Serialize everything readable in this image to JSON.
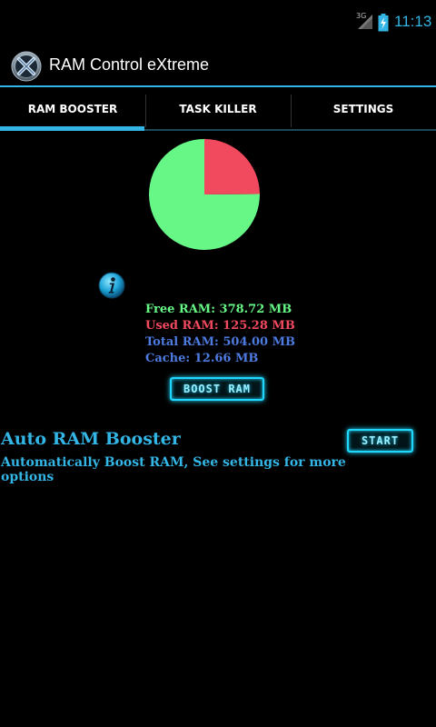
{
  "status_bar": {
    "network": "3G",
    "time": "11:13"
  },
  "app": {
    "title": "RAM Control eXtreme",
    "icon": "x-logo-icon"
  },
  "tabs": [
    {
      "label": "RAM BOOSTER",
      "selected": true
    },
    {
      "label": "TASK KILLER",
      "selected": false
    },
    {
      "label": "SETTINGS",
      "selected": false
    }
  ],
  "memory": {
    "free": "Free RAM: 378.72 MB",
    "used": "Used RAM: 125.28 MB",
    "total": "Total RAM: 504.00 MB",
    "cache": "Cache: 12.66 MB",
    "free_mb": 378.72,
    "used_mb": 125.28,
    "free_color": "#66f786",
    "used_color": "#f1495e",
    "total_color": "#4d7bdf",
    "cache_color": "#4d7bdf"
  },
  "boost_button": "BOOST RAM",
  "auto_booster": {
    "title": "Auto RAM Booster",
    "description": "Automatically Boost RAM, See settings for more options",
    "start_button": "START"
  },
  "colors": {
    "accent": "#33b5e5",
    "neon": "#1fd7ff"
  }
}
